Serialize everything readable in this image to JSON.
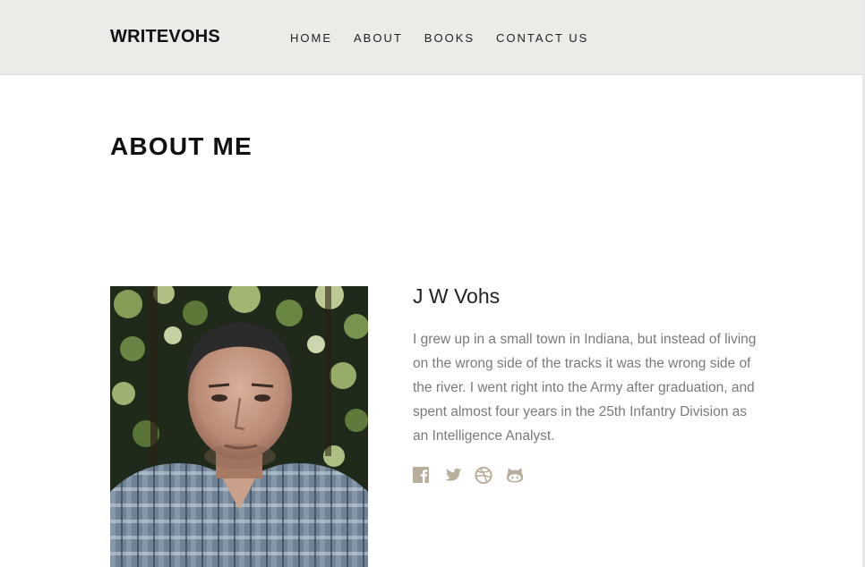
{
  "header": {
    "logo": "WRITEVOHS",
    "nav": [
      "HOME",
      "ABOUT",
      "BOOKS",
      "CONTACT US"
    ]
  },
  "page": {
    "title": "ABOUT ME"
  },
  "author": {
    "name": "J W Vohs",
    "bio": "I grew up in a small town in Indiana, but instead of living on the wrong side of the tracks it was the wrong side of the river. I went right into the Army after graduation, and spent almost four years in the 25th Infantry Division as an Intelligence Analyst."
  },
  "social": [
    "facebook-icon",
    "twitter-icon",
    "dribbble-icon",
    "github-icon"
  ],
  "colors": {
    "header_bg": "#ecebe8",
    "icon": "#b9ad9b",
    "bio_text": "#7a7a7a"
  }
}
